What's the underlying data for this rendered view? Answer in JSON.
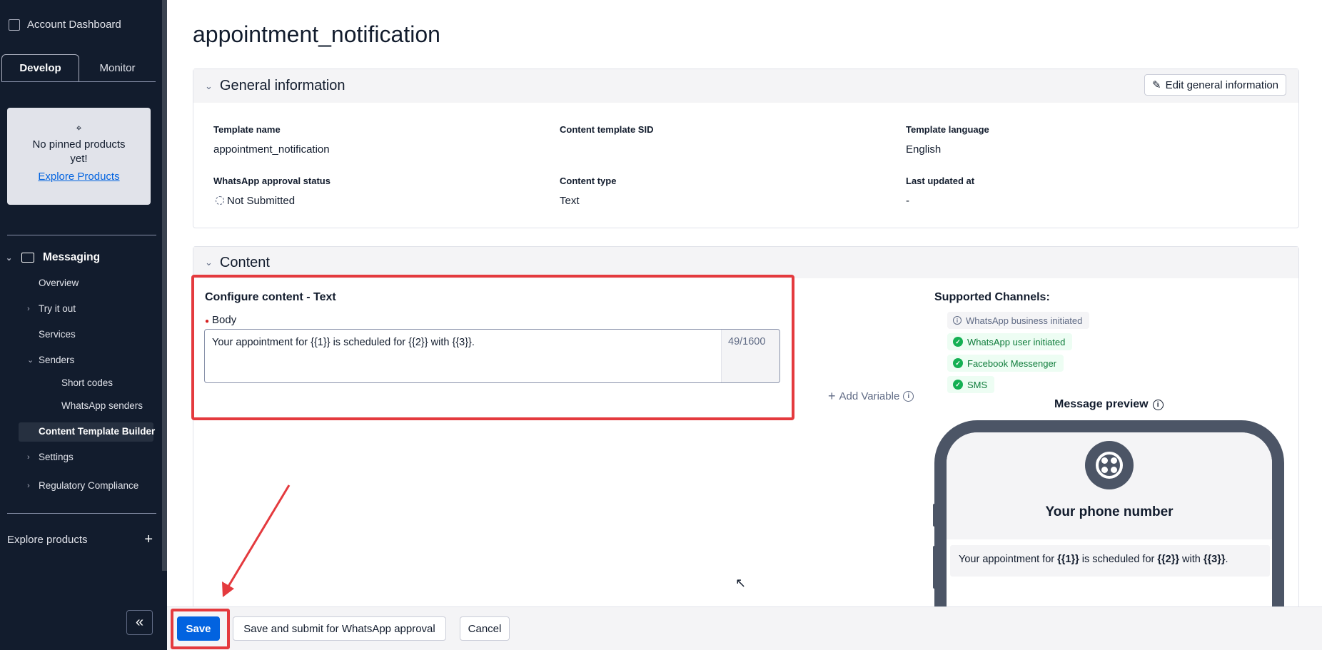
{
  "sidebar": {
    "header": "Account Dashboard",
    "tabs": [
      "Develop",
      "Monitor"
    ],
    "pinned": {
      "message": "No pinned products yet!",
      "link": "Explore Products"
    },
    "section": "Messaging",
    "items": {
      "overview": "Overview",
      "try_it_out": "Try it out",
      "services": "Services",
      "senders": "Senders",
      "short_codes": "Short codes",
      "whatsapp_senders": "WhatsApp senders",
      "content_template_builder": "Content Template Builder",
      "settings": "Settings",
      "regulatory_compliance": "Regulatory Compliance"
    },
    "explore": "Explore products"
  },
  "page": {
    "title": "appointment_notification"
  },
  "general": {
    "heading": "General information",
    "edit_label": "Edit general information",
    "fields": {
      "template_name_label": "Template name",
      "template_name_value": "appointment_notification",
      "sid_label": "Content template SID",
      "language_label": "Template language",
      "language_value": "English",
      "approval_label": "WhatsApp approval status",
      "approval_value": "Not Submitted",
      "type_label": "Content type",
      "type_value": "Text",
      "updated_label": "Last updated at",
      "updated_value": "-"
    }
  },
  "content": {
    "heading": "Content",
    "configure_title": "Configure content - Text",
    "body_label": "Body",
    "body_text": "Your appointment for {{1}} is scheduled for {{2}} with {{3}}.",
    "char_count": "49/1600",
    "add_variable": "Add Variable",
    "supported_title": "Supported Channels:",
    "channels": [
      "WhatsApp business initiated",
      "WhatsApp user initiated",
      "Facebook Messenger",
      "SMS"
    ],
    "preview_title": "Message preview",
    "phone_name": "Your phone number",
    "preview": {
      "p1": "Your appointment for ",
      "v1": "{{1}}",
      "p2": " is scheduled for ",
      "v2": "{{2}}",
      "p3": " with ",
      "v3": "{{3}}",
      "p4": "."
    }
  },
  "footer": {
    "save": "Save",
    "save_submit": "Save and submit for WhatsApp approval",
    "cancel": "Cancel"
  },
  "colors": {
    "sidebar_bg": "#121c2d",
    "primary": "#0263e0",
    "highlight": "#e43a3e",
    "success": "#14b053"
  }
}
